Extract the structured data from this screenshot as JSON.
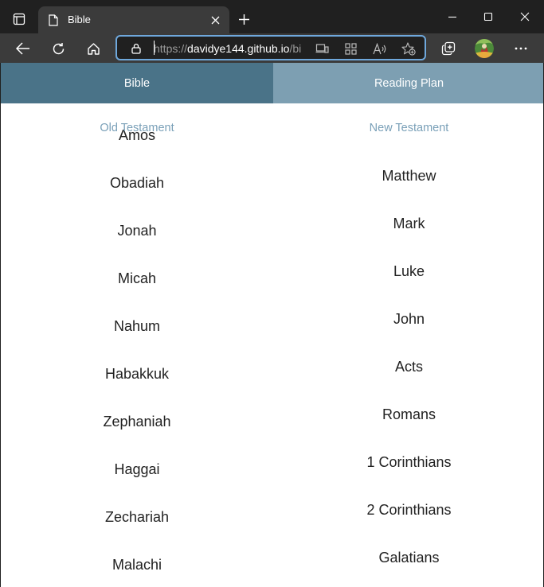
{
  "browser": {
    "tab_title": "Bible",
    "url_prefix": "https://",
    "url_host": "davidye144.github.io",
    "url_rest": "/bi"
  },
  "icons": {
    "tab_actions": "tab-actions-icon",
    "favicon": "page-icon",
    "tab_close": "close-icon",
    "new_tab": "plus-icon",
    "minimize": "minimize-icon",
    "maximize": "maximize-icon",
    "window_close": "close-icon",
    "back": "back-arrow-icon",
    "reload": "reload-icon",
    "home": "home-icon",
    "lock": "lock-icon",
    "app_available": "app-install-icon",
    "apps": "apps-grid-icon",
    "read_aloud": "read-aloud-icon",
    "favorites": "add-favorite-icon",
    "collections": "collections-icon",
    "profile": "profile-avatar",
    "more": "more-options-icon"
  },
  "colors": {
    "tab_active": "#4a7388",
    "tab_inactive": "#7d9fb2",
    "heading": "#7aa0b8",
    "book_text": "#222222",
    "address_focus": "#6fa8dc"
  },
  "nav": {
    "bible": "Bible",
    "reading_plan": "Reading Plan"
  },
  "old_testament": {
    "heading": "Old Testament",
    "books": [
      "Amos",
      "Obadiah",
      "Jonah",
      "Micah",
      "Nahum",
      "Habakkuk",
      "Zephaniah",
      "Haggai",
      "Zechariah",
      "Malachi"
    ]
  },
  "new_testament": {
    "heading": "New Testament",
    "books": [
      "Matthew",
      "Mark",
      "Luke",
      "John",
      "Acts",
      "Romans",
      "1 Corinthians",
      "2 Corinthians",
      "Galatians"
    ]
  }
}
